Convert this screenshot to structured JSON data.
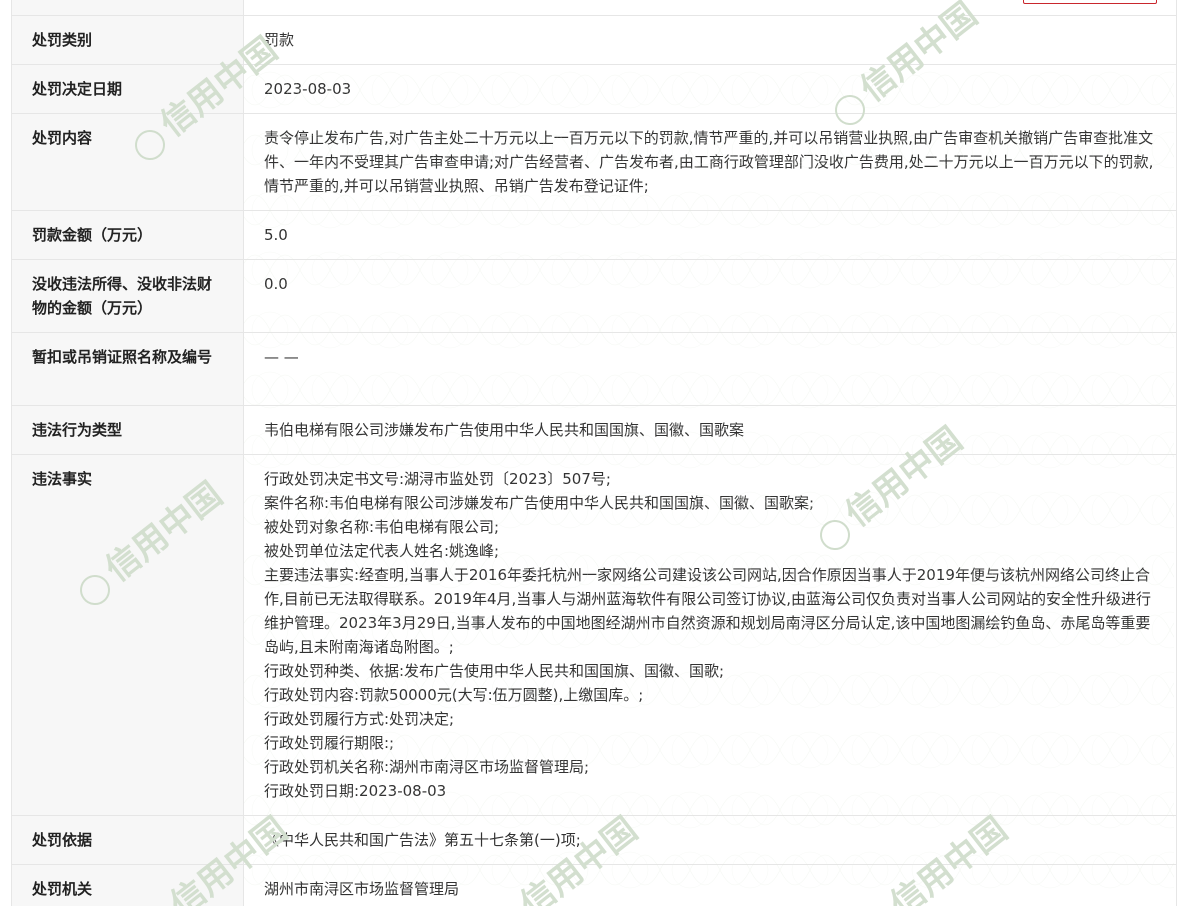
{
  "rows": [
    {
      "label": "处罚类别",
      "value": "罚款"
    },
    {
      "label": "处罚决定日期",
      "value": "2023-08-03"
    },
    {
      "label": "处罚内容",
      "value": "责令停止发布广告,对广告主处二十万元以上一百万元以下的罚款,情节严重的,并可以吊销营业执照,由广告审查机关撤销广告审查批准文件、一年内不受理其广告审查申请;对广告经营者、广告发布者,由工商行政管理部门没收广告费用,处二十万元以上一百万元以下的罚款,情节严重的,并可以吊销营业执照、吊销广告发布登记证件;"
    },
    {
      "label": "罚款金额（万元）",
      "value": "5.0"
    },
    {
      "label": "没收违法所得、没收非法财物的金额（万元）",
      "value": "0.0"
    },
    {
      "label": "暂扣或吊销证照名称及编号",
      "value": "— —"
    },
    {
      "label": "违法行为类型",
      "value": "韦伯电梯有限公司涉嫌发布广告使用中华人民共和国国旗、国徽、国歌案"
    },
    {
      "label": "违法事实",
      "value": "行政处罚决定书文号:湖浔市监处罚〔2023〕507号;\n案件名称:韦伯电梯有限公司涉嫌发布广告使用中华人民共和国国旗、国徽、国歌案;\n被处罚对象名称:韦伯电梯有限公司;\n被处罚单位法定代表人姓名:姚逸峰;\n主要违法事实:经查明,当事人于2016年委托杭州一家网络公司建设该公司网站,因合作原因当事人于2019年便与该杭州网络公司终止合作,目前已无法取得联系。2019年4月,当事人与湖州蓝海软件有限公司签订协议,由蓝海公司仅负责对当事人公司网站的安全性升级进行维护管理。2023年3月29日,当事人发布的中国地图经湖州市自然资源和规划局南浔区分局认定,该中国地图漏绘钓鱼岛、赤尾岛等重要岛屿,且未附南海诸岛附图。;\n行政处罚种类、依据:发布广告使用中华人民共和国国旗、国徽、国歌;\n行政处罚内容:罚款50000元(大写:伍万圆整),上缴国库。;\n行政处罚履行方式:处罚决定;\n行政处罚履行期限:;\n行政处罚机关名称:湖州市南浔区市场监督管理局;\n行政处罚日期:2023-08-03"
    },
    {
      "label": "处罚依据",
      "value": "《中华人民共和国广告法》第五十七条第(一)项;"
    },
    {
      "label": "处罚机关",
      "value": "湖州市南浔区市场监督管理局"
    }
  ],
  "watermark": {
    "text": "信用中国"
  },
  "colors": {
    "accent": "#c9272d",
    "border": "#e6e6e6",
    "label_bg": "#f7f7f7",
    "watermark": "#d6e3d2"
  }
}
